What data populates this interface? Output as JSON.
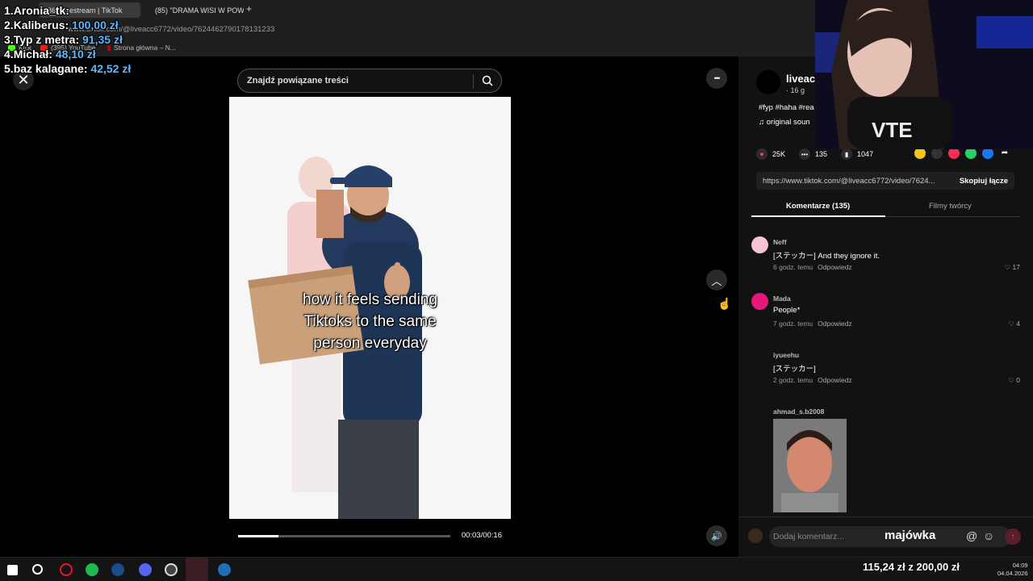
{
  "browser": {
    "tabs": [
      {
        "label": "(86) Livestream | TikTok",
        "active": true
      },
      {
        "label": "(85) \"DRAMA WISI W POW",
        "active": false
      }
    ],
    "new_tab": "+",
    "url": "www.tiktok.com/@liveacc6772/video/7624462790178131233",
    "bookmarks": [
      "Kick",
      "(395) YouTube",
      "Strona główna – N..."
    ]
  },
  "donations": [
    {
      "rank": "1.",
      "name": "Aronia_tk:",
      "amount": ""
    },
    {
      "rank": "2.",
      "name": "Kaliberus:",
      "amount": "100,00 zł"
    },
    {
      "rank": "3.",
      "name": "Typ z metra:",
      "amount": "91,35 zł"
    },
    {
      "rank": "4.",
      "name": "Michał:",
      "amount": "48,10 zł"
    },
    {
      "rank": "5.",
      "name": "baz kalagane:",
      "amount": "42,52 zł"
    }
  ],
  "player": {
    "close": "✕",
    "search_placeholder": "Znajdź powiązane treści",
    "caption_lines": [
      "how it feels sending",
      "Tiktoks to the same",
      "person everyday"
    ],
    "time": "00:03/00:16",
    "progress": 0.19,
    "more": "•••",
    "nav_up": "︿",
    "volume": "🔊"
  },
  "panel": {
    "author_name": "liveacc",
    "author_sub": "· 16 g",
    "description": "#fyp #haha #rea",
    "sound": "original soun",
    "stats": {
      "likes": "25K",
      "comments": "135",
      "saves": "1047"
    },
    "link": "https://www.tiktok.com/@liveacc6772/video/7624...",
    "copy_label": "Skopiuj łącze",
    "tab_comments": "Komentarze (135)",
    "tab_creator": "Filmy twórcy",
    "comments": [
      {
        "user": "Neff",
        "text": "[ステッカー] And they ignore it.",
        "time": "6 godz. temu",
        "reply": "Odpowiedz",
        "likes": "17",
        "avatar": "#f6c4d2"
      },
      {
        "user": "Mada",
        "text": "People*",
        "time": "7 godz. temu",
        "reply": "Odpowiedz",
        "likes": "4",
        "avatar": "#e8177a"
      },
      {
        "user": "iyueehu",
        "text": "[ステッカー]",
        "time": "2 godz. temu",
        "reply": "Odpowiedz",
        "likes": "0",
        "avatar": "#111111"
      },
      {
        "user": "ahmad_s.b2008",
        "text": "",
        "time": "",
        "reply": "",
        "likes": "",
        "avatar": "#111111"
      }
    ],
    "comment_placeholder": "Dodaj komentarz...",
    "overlay_text": "majówka",
    "at": "@",
    "emoji": "☺",
    "send": "↑"
  },
  "taskbar": {
    "goal": "115,24 zł z 200,00 zł",
    "time": "04:09",
    "date": "04.04.2026"
  }
}
